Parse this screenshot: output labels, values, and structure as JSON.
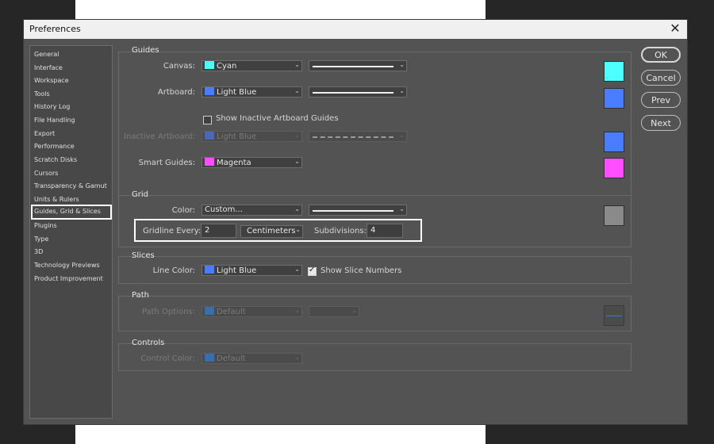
{
  "window": {
    "title": "Preferences",
    "close_glyph": "✕"
  },
  "sidebar": {
    "items": [
      {
        "label": "General"
      },
      {
        "label": "Interface"
      },
      {
        "label": "Workspace"
      },
      {
        "label": "Tools"
      },
      {
        "label": "History Log"
      },
      {
        "label": "File Handling"
      },
      {
        "label": "Export"
      },
      {
        "label": "Performance"
      },
      {
        "label": "Scratch Disks"
      },
      {
        "label": "Cursors"
      },
      {
        "label": "Transparency & Gamut"
      },
      {
        "label": "Units & Rulers"
      },
      {
        "label": "Guides, Grid & Slices",
        "selected": true
      },
      {
        "label": "Plugins"
      },
      {
        "label": "Type"
      },
      {
        "label": "3D"
      },
      {
        "label": "Technology Previews"
      },
      {
        "label": "Product Improvement"
      }
    ]
  },
  "guides": {
    "title": "Guides",
    "canvas": {
      "label": "Canvas:",
      "color": "Cyan",
      "swatch": "#4dffff",
      "style": "solid"
    },
    "artboard": {
      "label": "Artboard:",
      "color": "Light Blue",
      "swatch": "#4a7cff",
      "style": "solid"
    },
    "show_inactive": {
      "label": "Show Inactive Artboard Guides",
      "checked": false
    },
    "inactive_artboard": {
      "label": "Inactive Artboard:",
      "color": "Light Blue",
      "swatch": "#4a7cff",
      "style": "dashed"
    },
    "smart_guides": {
      "label": "Smart Guides:",
      "color": "Magenta",
      "swatch": "#ff4dff"
    }
  },
  "grid": {
    "title": "Grid",
    "color": {
      "label": "Color:",
      "value": "Custom...",
      "swatch": "#8a8a8a"
    },
    "gridline_every": {
      "label": "Gridline Every:",
      "value": "2",
      "unit": "Centimeters"
    },
    "subdivisions": {
      "label": "Subdivisions:",
      "value": "4"
    }
  },
  "slices": {
    "title": "Slices",
    "line_color": {
      "label": "Line Color:",
      "value": "Light Blue",
      "swatch": "#4a7cff"
    },
    "show_numbers": {
      "label": "Show Slice Numbers",
      "checked": true
    }
  },
  "path": {
    "title": "Path",
    "options": {
      "label": "Path Options:",
      "value": "Default",
      "swatch": "#2f7fd8"
    }
  },
  "controls": {
    "title": "Controls",
    "color": {
      "label": "Control Color:",
      "value": "Default",
      "swatch": "#2f7fd8"
    }
  },
  "buttons": {
    "ok": "OK",
    "cancel": "Cancel",
    "prev": "Prev",
    "next": "Next"
  },
  "colors": {
    "dialog_bg": "#535353",
    "sidebar_bg": "#484848",
    "highlight": "#ffffff"
  }
}
